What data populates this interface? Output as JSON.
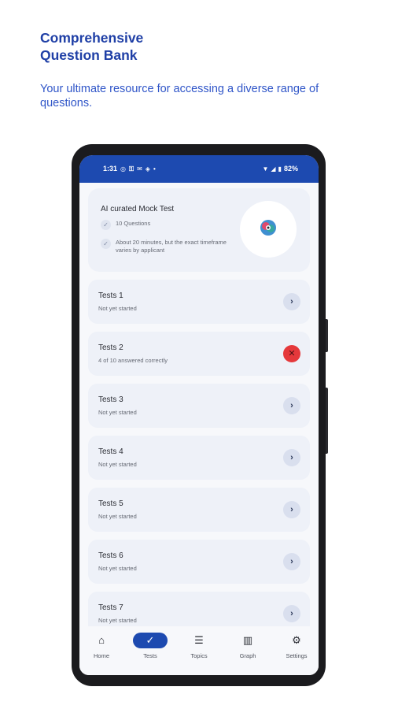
{
  "promo": {
    "headline_line1": "Comprehensive",
    "headline_line2": "Question Bank",
    "subline": "Your ultimate resource for accessing a diverse range of questions."
  },
  "statusbar": {
    "time": "1:31",
    "battery": "82%",
    "left_icons": [
      "whatsapp-icon",
      "key-icon",
      "gmail-icon",
      "location-icon",
      "dot-icon"
    ],
    "right_icons": [
      "wifi-icon",
      "signal-icon",
      "battery-icon"
    ]
  },
  "hero": {
    "title": "AI curated Mock Test",
    "item1": "10 Questions",
    "item2": "About 20 minutes, but the exact timeframe varies by applicant",
    "badge_icon": "brain-gear-icon"
  },
  "tests": [
    {
      "title": "Tests 1",
      "status": "Not yet started",
      "action": "chevron"
    },
    {
      "title": "Tests 2",
      "status": "4 of 10 answered correctly",
      "action": "fail"
    },
    {
      "title": "Tests 3",
      "status": "Not yet started",
      "action": "chevron"
    },
    {
      "title": "Tests 4",
      "status": "Not yet started",
      "action": "chevron"
    },
    {
      "title": "Tests 5",
      "status": "Not yet started",
      "action": "chevron"
    },
    {
      "title": "Tests 6",
      "status": "Not yet started",
      "action": "chevron"
    },
    {
      "title": "Tests 7",
      "status": "Not yet started",
      "action": "chevron"
    }
  ],
  "nav": {
    "active": "Tests",
    "items": [
      {
        "label": "Home",
        "icon": "home-icon"
      },
      {
        "label": "Tests",
        "icon": "check-icon"
      },
      {
        "label": "Topics",
        "icon": "list-icon"
      },
      {
        "label": "Graph",
        "icon": "bar-chart-icon"
      },
      {
        "label": "Settings",
        "icon": "gear-icon"
      }
    ]
  },
  "colors": {
    "brand_blue": "#1d4ab0",
    "headline_blue": "#1f3fa6",
    "fail_red": "#e5383b",
    "card_bg": "#eef1f8"
  }
}
